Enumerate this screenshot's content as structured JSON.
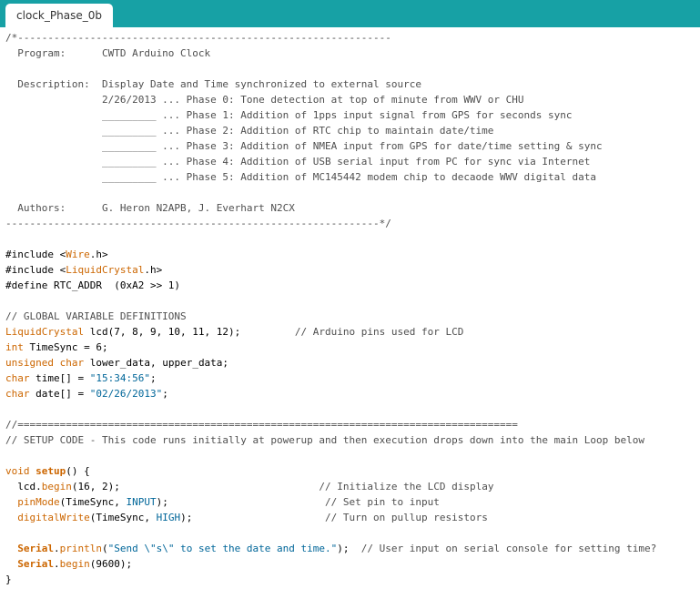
{
  "tab": {
    "label": "clock_Phase_0b"
  },
  "colors": {
    "tabbar": "#17a1a5",
    "comment": "#4f4f4f",
    "keyword": "#cc6600",
    "constant": "#006699",
    "string": "#006699",
    "plain": "#000000"
  },
  "code_lines": [
    [
      {
        "t": "comment",
        "v": "/*--------------------------------------------------------------"
      }
    ],
    [
      {
        "t": "comment",
        "v": "  Program:      CWTD Arduino Clock"
      }
    ],
    [
      {
        "t": "comment",
        "v": ""
      }
    ],
    [
      {
        "t": "comment",
        "v": "  Description:  Display Date and Time synchronized to external source"
      }
    ],
    [
      {
        "t": "comment",
        "v": "                2/26/2013 ... Phase 0: Tone detection at top of minute from WWV or CHU"
      }
    ],
    [
      {
        "t": "comment",
        "v": "                _________ ... Phase 1: Addition of 1pps input signal from GPS for seconds sync"
      }
    ],
    [
      {
        "t": "comment",
        "v": "                _________ ... Phase 2: Addition of RTC chip to maintain date/time"
      }
    ],
    [
      {
        "t": "comment",
        "v": "                _________ ... Phase 3: Addition of NMEA input from GPS for date/time setting & sync"
      }
    ],
    [
      {
        "t": "comment",
        "v": "                _________ ... Phase 4: Addition of USB serial input from PC for sync via Internet"
      }
    ],
    [
      {
        "t": "comment",
        "v": "                _________ ... Phase 5: Addition of MC145442 modem chip to decaode WWV digital data"
      }
    ],
    [
      {
        "t": "comment",
        "v": ""
      }
    ],
    [
      {
        "t": "comment",
        "v": "  Authors:      G. Heron N2APB, J. Everhart N2CX"
      }
    ],
    [
      {
        "t": "comment",
        "v": "--------------------------------------------------------------*/"
      }
    ],
    [
      {
        "t": "plain",
        "v": ""
      }
    ],
    [
      {
        "t": "plain",
        "v": "#include <"
      },
      {
        "t": "type",
        "v": "Wire"
      },
      {
        "t": "plain",
        "v": ".h>"
      }
    ],
    [
      {
        "t": "plain",
        "v": "#include <"
      },
      {
        "t": "type",
        "v": "LiquidCrystal"
      },
      {
        "t": "plain",
        "v": ".h>"
      }
    ],
    [
      {
        "t": "plain",
        "v": "#define RTC_ADDR  (0xA2 >> 1)"
      }
    ],
    [
      {
        "t": "plain",
        "v": ""
      }
    ],
    [
      {
        "t": "comment",
        "v": "// GLOBAL VARIABLE DEFINITIONS"
      }
    ],
    [
      {
        "t": "type",
        "v": "LiquidCrystal"
      },
      {
        "t": "plain",
        "v": " lcd(7, 8, 9, 10, 11, 12);         "
      },
      {
        "t": "comment",
        "v": "// Arduino pins used for LCD"
      }
    ],
    [
      {
        "t": "type",
        "v": "int"
      },
      {
        "t": "plain",
        "v": " TimeSync = 6;"
      }
    ],
    [
      {
        "t": "type",
        "v": "unsigned"
      },
      {
        "t": "plain",
        "v": " "
      },
      {
        "t": "type",
        "v": "char"
      },
      {
        "t": "plain",
        "v": " lower_data, upper_data;"
      }
    ],
    [
      {
        "t": "type",
        "v": "char"
      },
      {
        "t": "plain",
        "v": " time[] = "
      },
      {
        "t": "string",
        "v": "\"15:34:56\""
      },
      {
        "t": "plain",
        "v": ";"
      }
    ],
    [
      {
        "t": "type",
        "v": "char"
      },
      {
        "t": "plain",
        "v": " date[] = "
      },
      {
        "t": "string",
        "v": "\"02/26/2013\""
      },
      {
        "t": "plain",
        "v": ";"
      }
    ],
    [
      {
        "t": "plain",
        "v": ""
      }
    ],
    [
      {
        "t": "comment",
        "v": "//==================================================================================="
      }
    ],
    [
      {
        "t": "comment",
        "v": "// SETUP CODE - This code runs initially at powerup and then execution drops down into the main Loop below"
      }
    ],
    [
      {
        "t": "plain",
        "v": ""
      }
    ],
    [
      {
        "t": "type",
        "v": "void"
      },
      {
        "t": "plain",
        "v": " "
      },
      {
        "t": "funcbold",
        "v": "setup"
      },
      {
        "t": "plain",
        "v": "() {"
      }
    ],
    [
      {
        "t": "plain",
        "v": "  lcd."
      },
      {
        "t": "func",
        "v": "begin"
      },
      {
        "t": "plain",
        "v": "(16, 2);                                 "
      },
      {
        "t": "comment",
        "v": "// Initialize the LCD display"
      }
    ],
    [
      {
        "t": "plain",
        "v": "  "
      },
      {
        "t": "func",
        "v": "pinMode"
      },
      {
        "t": "plain",
        "v": "(TimeSync, "
      },
      {
        "t": "const",
        "v": "INPUT"
      },
      {
        "t": "plain",
        "v": ");                          "
      },
      {
        "t": "comment",
        "v": "// Set pin to input"
      }
    ],
    [
      {
        "t": "plain",
        "v": "  "
      },
      {
        "t": "func",
        "v": "digitalWrite"
      },
      {
        "t": "plain",
        "v": "(TimeSync, "
      },
      {
        "t": "const",
        "v": "HIGH"
      },
      {
        "t": "plain",
        "v": ");                      "
      },
      {
        "t": "comment",
        "v": "// Turn on pullup resistors"
      }
    ],
    [
      {
        "t": "plain",
        "v": ""
      }
    ],
    [
      {
        "t": "plain",
        "v": "  "
      },
      {
        "t": "funcbold",
        "v": "Serial"
      },
      {
        "t": "plain",
        "v": "."
      },
      {
        "t": "func",
        "v": "println"
      },
      {
        "t": "plain",
        "v": "("
      },
      {
        "t": "string",
        "v": "\"Send \\\"s\\\" to set the date and time.\""
      },
      {
        "t": "plain",
        "v": ");  "
      },
      {
        "t": "comment",
        "v": "// User input on serial console for setting time?"
      }
    ],
    [
      {
        "t": "plain",
        "v": "  "
      },
      {
        "t": "funcbold",
        "v": "Serial"
      },
      {
        "t": "plain",
        "v": "."
      },
      {
        "t": "func",
        "v": "begin"
      },
      {
        "t": "plain",
        "v": "(9600);"
      }
    ],
    [
      {
        "t": "plain",
        "v": "}"
      }
    ]
  ]
}
